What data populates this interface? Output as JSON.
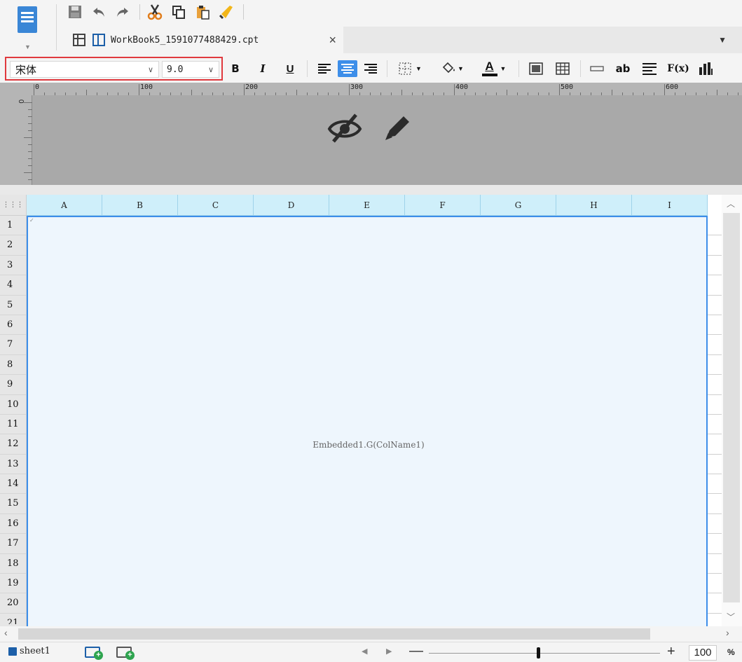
{
  "toolbar": {
    "quick_access": [
      "save-icon",
      "undo-icon",
      "redo-icon",
      "cut-icon",
      "copy-icon",
      "paste-icon",
      "format-painter-icon"
    ]
  },
  "tab": {
    "title": "WorkBook5_1591077488429.cpt",
    "close": "×"
  },
  "format": {
    "font_name": "宋体",
    "font_size": "9.0",
    "bold_label": "B",
    "italic_label": "I",
    "underline_label": "U",
    "text_color_label": "A",
    "wrap_label": "ab",
    "formula_label": "F(x)",
    "accent_color": "#3d8ee9",
    "highlight_border_color": "#e0393e"
  },
  "ruler": {
    "labels": [
      "0",
      "100",
      "200",
      "300",
      "400",
      "500",
      "600"
    ],
    "vertical_zero": "0"
  },
  "grid": {
    "columns": [
      "A",
      "B",
      "C",
      "D",
      "E",
      "F",
      "G",
      "H",
      "I"
    ],
    "rows": [
      "1",
      "2",
      "3",
      "4",
      "5",
      "6",
      "7",
      "8",
      "9",
      "10",
      "11",
      "12",
      "13",
      "14",
      "15",
      "16",
      "17",
      "18",
      "19",
      "20",
      "21"
    ],
    "cell_text": "Embedded1.G(ColName1)"
  },
  "status": {
    "sheet_name": "sheet1",
    "zoom_value": "100",
    "zoom_unit": "%",
    "zoom_minus": "—",
    "zoom_plus": "+"
  }
}
